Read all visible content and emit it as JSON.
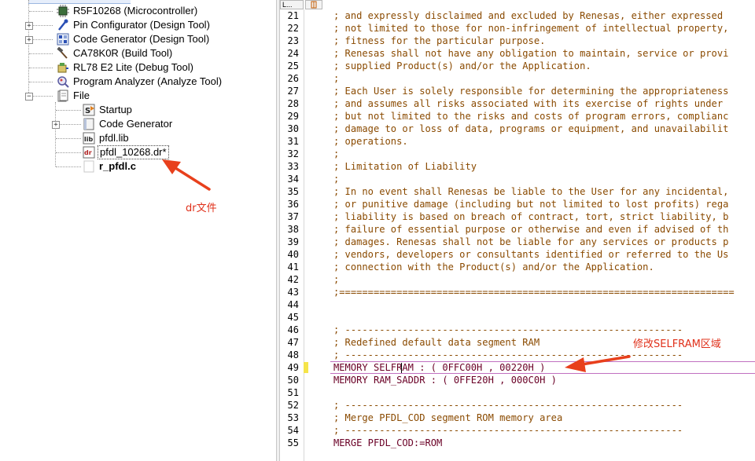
{
  "tree": {
    "items": [
      {
        "label": "R5F10268 (Microcontroller)",
        "icon": "chip-icon"
      },
      {
        "label": "Pin Configurator (Design Tool)",
        "icon": "pin-configurator-icon"
      },
      {
        "label": "Code Generator (Design Tool)",
        "icon": "code-generator-icon"
      },
      {
        "label": "CA78K0R (Build Tool)",
        "icon": "hammer-icon"
      },
      {
        "label": "RL78 E2 Lite (Debug Tool)",
        "icon": "debug-tool-icon"
      },
      {
        "label": "Program Analyzer (Analyze Tool)",
        "icon": "analyzer-icon"
      },
      {
        "label": "File",
        "icon": "folder-icon"
      },
      {
        "label": "Startup",
        "icon": "startup-folder-icon"
      },
      {
        "label": "Code Generator",
        "icon": "folder-icon"
      },
      {
        "label": "pfdl.lib",
        "icon": "lib-file-icon"
      },
      {
        "label": "pfdl_10268.dr*",
        "icon": "dr-file-icon"
      },
      {
        "label": "r_pfdl.c",
        "icon": "c-file-icon"
      }
    ]
  },
  "editor": {
    "gutter_header": "L...",
    "line_numbers": [
      "21",
      "22",
      "23",
      "24",
      "25",
      "26",
      "27",
      "28",
      "29",
      "30",
      "31",
      "32",
      "33",
      "34",
      "35",
      "36",
      "37",
      "38",
      "39",
      "40",
      "41",
      "42",
      "43",
      "44",
      "45",
      "46",
      "47",
      "48",
      "49",
      "50",
      "51",
      "52",
      "53",
      "54",
      "55"
    ],
    "lines": [
      {
        "text": "; and expressly disclaimed and excluded by Renesas, either expressed",
        "kind": "comment"
      },
      {
        "text": "; not limited to those for non-infringement of intellectual property,",
        "kind": "comment"
      },
      {
        "text": "; fitness for the particular purpose.",
        "kind": "comment"
      },
      {
        "text": "; Renesas shall not have any obligation to maintain, service or provi",
        "kind": "comment"
      },
      {
        "text": "; supplied Product(s) and/or the Application.",
        "kind": "comment"
      },
      {
        "text": ";",
        "kind": "comment"
      },
      {
        "text": "; Each User is solely responsible for determining the appropriateness",
        "kind": "comment"
      },
      {
        "text": "; and assumes all risks associated with its exercise of rights under",
        "kind": "comment"
      },
      {
        "text": "; but not limited to the risks and costs of program errors, complianc",
        "kind": "comment"
      },
      {
        "text": "; damage to or loss of data, programs or equipment, and unavailabilit",
        "kind": "comment"
      },
      {
        "text": "; operations.",
        "kind": "comment"
      },
      {
        "text": ";",
        "kind": "comment"
      },
      {
        "text": "; Limitation of Liability",
        "kind": "comment"
      },
      {
        "text": ";",
        "kind": "comment"
      },
      {
        "text": "; In no event shall Renesas be liable to the User for any incidental,",
        "kind": "comment"
      },
      {
        "text": "; or punitive damage (including but not limited to lost profits) rega",
        "kind": "comment"
      },
      {
        "text": "; liability is based on breach of contract, tort, strict liability, b",
        "kind": "comment"
      },
      {
        "text": "; failure of essential purpose or otherwise and even if advised of th",
        "kind": "comment"
      },
      {
        "text": "; damages. Renesas shall not be liable for any services or products p",
        "kind": "comment"
      },
      {
        "text": "; vendors, developers or consultants identified or referred to the Us",
        "kind": "comment"
      },
      {
        "text": "; connection with the Product(s) and/or the Application.",
        "kind": "comment"
      },
      {
        "text": ";",
        "kind": "comment"
      },
      {
        "text": ";=====================================================================",
        "kind": "comment"
      },
      {
        "text": "",
        "kind": "comment"
      },
      {
        "text": "",
        "kind": "comment"
      },
      {
        "text": "; -----------------------------------------------------------",
        "kind": "comment"
      },
      {
        "text": "; Redefined default data segment RAM",
        "kind": "comment"
      },
      {
        "text": "; -----------------------------------------------------------",
        "kind": "comment"
      },
      {
        "text": "MEMORY SELFRAM : ( 0FFC00H , 00220H )",
        "kind": "code"
      },
      {
        "text": "MEMORY RAM_SADDR : ( 0FFE20H , 000C0H )",
        "kind": "code"
      },
      {
        "text": "",
        "kind": "comment"
      },
      {
        "text": "; -----------------------------------------------------------",
        "kind": "comment"
      },
      {
        "text": "; Merge PFDL_COD segment ROM memory area",
        "kind": "comment"
      },
      {
        "text": "; -----------------------------------------------------------",
        "kind": "comment"
      },
      {
        "text": "MERGE PFDL_COD:=ROM",
        "kind": "code"
      }
    ]
  },
  "annotations": {
    "dr_file": "dr文件",
    "selfram": "修改SELFRAM区域",
    "arrow_color": "#e8401c"
  }
}
